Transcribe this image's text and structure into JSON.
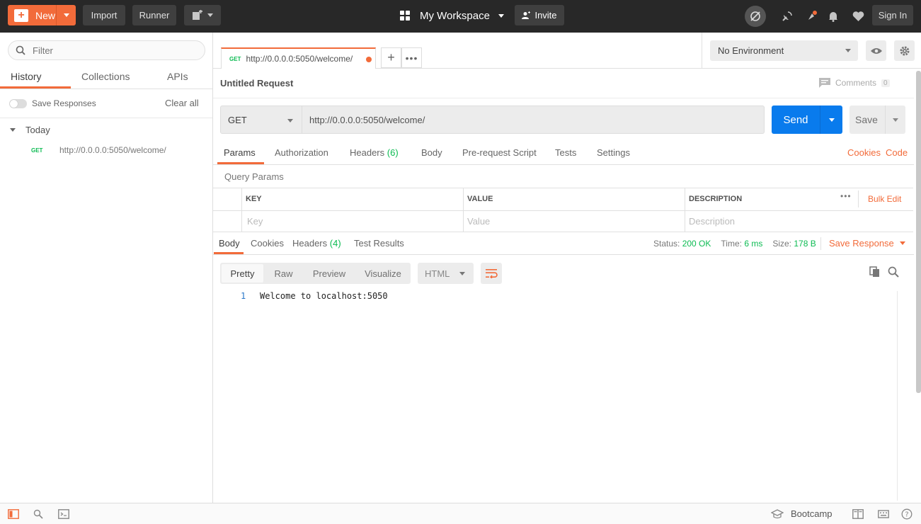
{
  "topbar": {
    "new_label": "New",
    "import_label": "Import",
    "runner_label": "Runner",
    "workspace_label": "My Workspace",
    "invite_label": "Invite",
    "signin_label": "Sign In"
  },
  "sidebar": {
    "filter_placeholder": "Filter",
    "tabs": [
      "History",
      "Collections",
      "APIs"
    ],
    "save_responses_label": "Save Responses",
    "clear_all_label": "Clear all",
    "group_label": "Today",
    "history_items": [
      {
        "method": "GET",
        "url": "http://0.0.0.0:5050/welcome/"
      }
    ]
  },
  "request_tab": {
    "method": "GET",
    "url": "http://0.0.0.0:5050/welcome/"
  },
  "environment": {
    "selected": "No Environment"
  },
  "request": {
    "title": "Untitled Request",
    "comments_label": "Comments",
    "comments_count": "0",
    "method": "GET",
    "url": "http://0.0.0.0:5050/welcome/",
    "send_label": "Send",
    "save_label": "Save",
    "tabs": {
      "params": "Params",
      "authorization": "Authorization",
      "headers": "Headers",
      "headers_count": "(6)",
      "body": "Body",
      "prerequest": "Pre-request Script",
      "tests": "Tests",
      "settings": "Settings"
    },
    "cookies_link": "Cookies",
    "code_link": "Code",
    "query_params_label": "Query Params",
    "table": {
      "key_header": "KEY",
      "value_header": "VALUE",
      "description_header": "DESCRIPTION",
      "bulk_edit": "Bulk Edit",
      "key_placeholder": "Key",
      "value_placeholder": "Value",
      "description_placeholder": "Description"
    }
  },
  "response": {
    "tabs": {
      "body": "Body",
      "cookies": "Cookies",
      "headers": "Headers",
      "headers_count": "(4)",
      "test_results": "Test Results"
    },
    "status_label": "Status:",
    "status_value": "200 OK",
    "time_label": "Time:",
    "time_value": "6 ms",
    "size_label": "Size:",
    "size_value": "178 B",
    "save_response_label": "Save Response",
    "view_modes": [
      "Pretty",
      "Raw",
      "Preview",
      "Visualize"
    ],
    "language": "HTML",
    "lines": [
      {
        "number": "1",
        "text": "Welcome to localhost:5050"
      }
    ]
  },
  "statusbar": {
    "bootcamp_label": "Bootcamp"
  }
}
